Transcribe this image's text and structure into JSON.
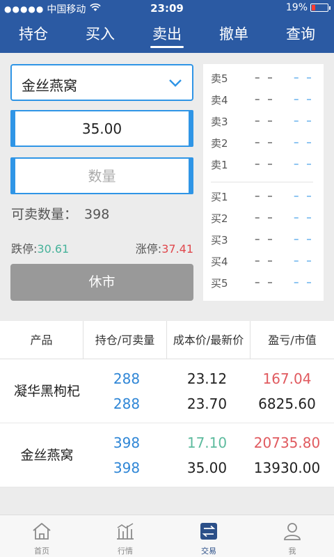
{
  "status_bar": {
    "signal": "●●●●●",
    "carrier": "中国移动",
    "time": "23:09",
    "battery_text": "19%"
  },
  "tabs": [
    "持仓",
    "买入",
    "卖出",
    "撤单",
    "查询"
  ],
  "active_tab": "卖出",
  "form": {
    "product_selected": "金丝燕窝",
    "price_value": "35.00",
    "quantity_placeholder": "数量",
    "available_label": "可卖数量：",
    "available_value": "398",
    "limit_down_label": "跌停:",
    "limit_down_value": "30.61",
    "limit_up_label": "涨停:",
    "limit_up_value": "37.41",
    "submit_label": "休市"
  },
  "quotes": {
    "sell": [
      {
        "label": "卖5",
        "price": "– –",
        "volume": "– –"
      },
      {
        "label": "卖4",
        "price": "– –",
        "volume": "– –"
      },
      {
        "label": "卖3",
        "price": "– –",
        "volume": "– –"
      },
      {
        "label": "卖2",
        "price": "– –",
        "volume": "– –"
      },
      {
        "label": "卖1",
        "price": "– –",
        "volume": "– –"
      }
    ],
    "buy": [
      {
        "label": "买1",
        "price": "– –",
        "volume": "– –"
      },
      {
        "label": "买2",
        "price": "– –",
        "volume": "– –"
      },
      {
        "label": "买3",
        "price": "– –",
        "volume": "– –"
      },
      {
        "label": "买4",
        "price": "– –",
        "volume": "– –"
      },
      {
        "label": "买5",
        "price": "– –",
        "volume": "– –"
      }
    ]
  },
  "table": {
    "headers": [
      "产品",
      "持仓/可卖量",
      "成本价/最新价",
      "盈亏/市值"
    ],
    "rows": [
      {
        "name": "凝华黑枸杞",
        "position": "288",
        "sellable": "288",
        "cost": "23.12",
        "latest": "23.70",
        "pnl": "167.04",
        "market_value": "6825.60"
      },
      {
        "name": "金丝燕窝",
        "position": "398",
        "sellable": "398",
        "cost": "17.10",
        "latest": "35.00",
        "pnl": "20735.80",
        "market_value": "13930.00"
      }
    ]
  },
  "bottom_nav": [
    {
      "label": "首页",
      "icon": "home-icon"
    },
    {
      "label": "行情",
      "icon": "market-chart-icon"
    },
    {
      "label": "交易",
      "icon": "trade-exchange-icon"
    },
    {
      "label": "我",
      "icon": "user-profile-icon"
    }
  ],
  "active_nav": "交易",
  "colors": {
    "header_blue": "#2b5aa3",
    "accent_blue": "#2f95e6",
    "up_red": "#e0474c",
    "down_green": "#46b29a",
    "disabled_gray": "#999999"
  }
}
